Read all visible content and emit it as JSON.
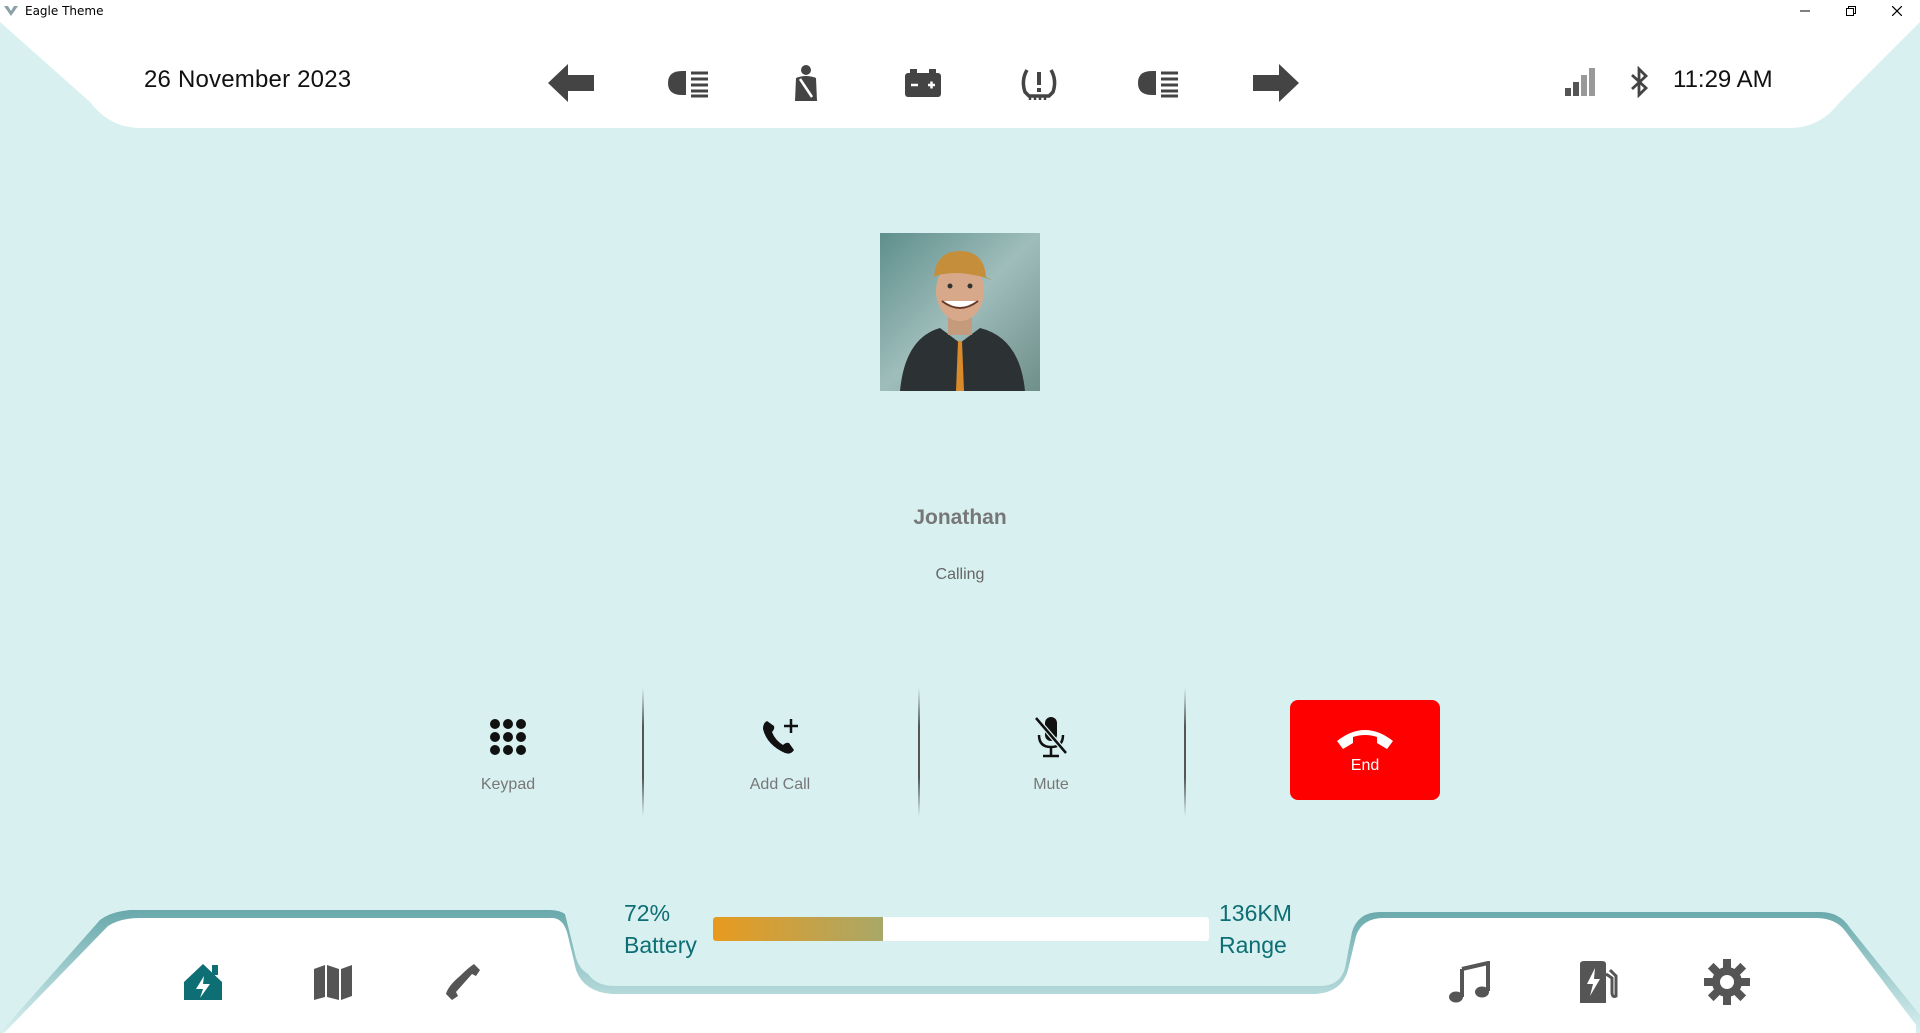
{
  "window": {
    "title": "Eagle Theme"
  },
  "topbar": {
    "date": "26 November 2023",
    "time": "11:29 AM",
    "indicators": [
      "left-turn-arrow-icon",
      "low-beam-icon",
      "seatbelt-icon",
      "battery-warning-icon",
      "tire-pressure-icon",
      "fog-light-icon",
      "right-turn-arrow-icon"
    ],
    "status_icons": [
      "signal-strength-icon",
      "bluetooth-icon"
    ]
  },
  "call": {
    "caller_name": "Jonathan",
    "status": "Calling",
    "actions": {
      "keypad": "Keypad",
      "add_call": "Add Call",
      "mute": "Mute",
      "end": "End"
    }
  },
  "dock": {
    "battery_percent": "72%",
    "battery_label": "Battery",
    "battery_level": 0.342,
    "range_value": "136KM",
    "range_label": "Range",
    "left_items": [
      "home-icon",
      "map-icon",
      "phone-icon"
    ],
    "right_items": [
      "music-icon",
      "charging-station-icon",
      "settings-icon"
    ]
  },
  "colors": {
    "background": "#d8f0f0",
    "accent": "#0d6e73",
    "end_call": "#ff0000",
    "battery_start": "#e89a1f",
    "battery_end": "#a9a868"
  }
}
